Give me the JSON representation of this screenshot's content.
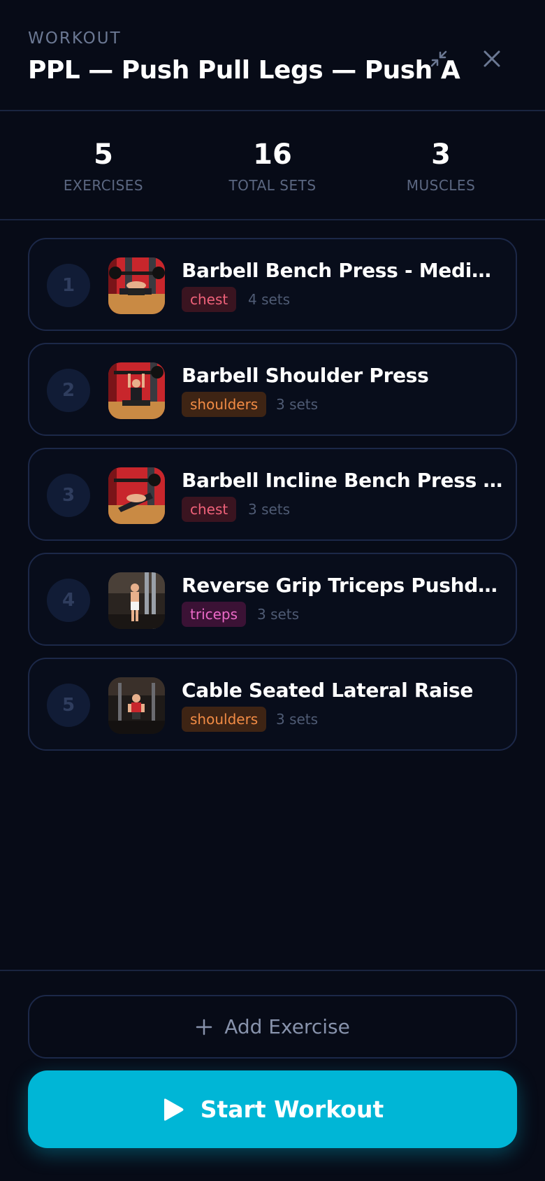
{
  "header": {
    "eyebrow": "WORKOUT",
    "title": "PPL — Push Pull Legs — Push A",
    "minimize_icon": "collapse-icon",
    "close_icon": "close-icon"
  },
  "stats": [
    {
      "value": "5",
      "label": "EXERCISES"
    },
    {
      "value": "16",
      "label": "TOTAL SETS"
    },
    {
      "value": "3",
      "label": "MUSCLES"
    }
  ],
  "exercises": [
    {
      "num": "1",
      "name": "Barbell Bench Press - Medium Grip",
      "muscle": "chest",
      "sets": "4 sets"
    },
    {
      "num": "2",
      "name": "Barbell Shoulder Press",
      "muscle": "shoulders",
      "sets": "3 sets"
    },
    {
      "num": "3",
      "name": "Barbell Incline Bench Press - Medium Grip",
      "muscle": "chest",
      "sets": "3 sets"
    },
    {
      "num": "4",
      "name": "Reverse Grip Triceps Pushdown",
      "muscle": "triceps",
      "sets": "3 sets"
    },
    {
      "num": "5",
      "name": "Cable Seated Lateral Raise",
      "muscle": "shoulders",
      "sets": "3 sets"
    }
  ],
  "actions": {
    "add_label": "Add Exercise",
    "start_label": "Start Workout"
  },
  "colors": {
    "background": "#070b17",
    "accent": "#00b6d6",
    "chest": "#f0627a",
    "shoulders": "#f28c45",
    "triceps": "#ec6ac8"
  }
}
